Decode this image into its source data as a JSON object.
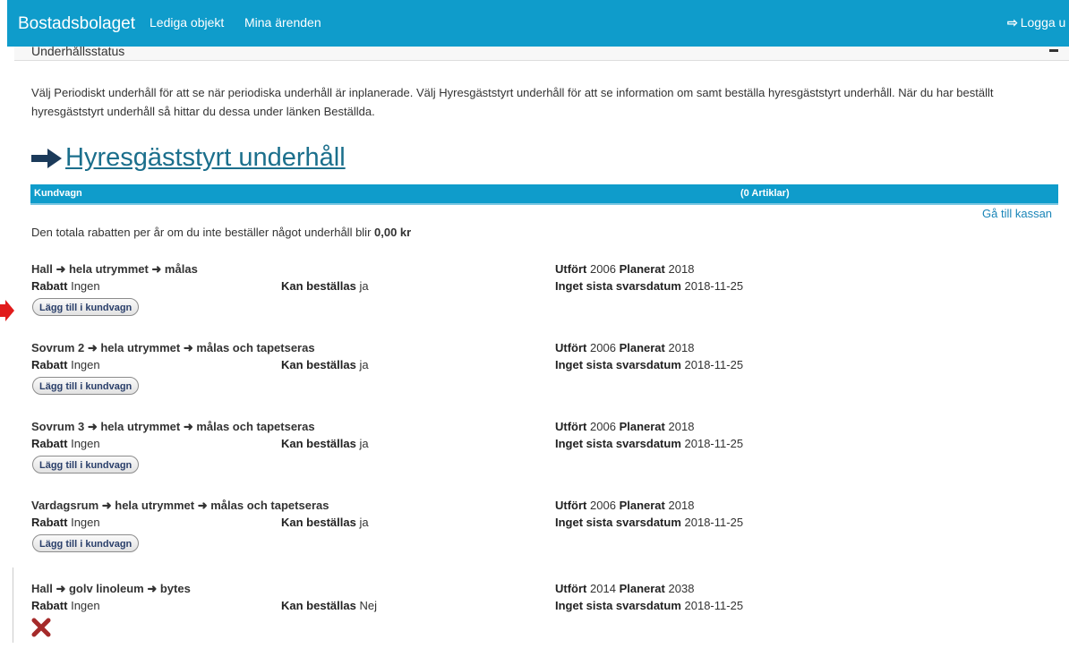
{
  "nav": {
    "brand": "Bostadsbolaget",
    "links": [
      "Lediga objekt",
      "Mina ärenden"
    ],
    "logout": "Logga u"
  },
  "panel": {
    "title": "Underhållsstatus"
  },
  "intro": "Välj Periodiskt underhåll för att se när periodiska underhåll är inplanerade. Välj Hyresgäststyrt underhåll för att se information om samt beställa hyresgäststyrt underhåll. När du har beställt hyresgäststyrt underhåll så hittar du dessa under länken Beställda.",
  "section_title": "Hyresgäststyrt underhåll",
  "cart": {
    "label": "Kundvagn",
    "count": "(0 Artiklar)"
  },
  "checkout": "Gå till kassan",
  "discount": {
    "text": "Den totala rabatten per år om du inte beställer något underhåll blir ",
    "amount": "0,00 kr"
  },
  "labels": {
    "done": "Utfört",
    "planned": "Planerat",
    "discount": "Rabatt",
    "orderable": "Kan beställas",
    "no_deadline": "Inget sista svarsdatum",
    "add_button": "Lägg till i kundvagn"
  },
  "arrow_glyph": "➜",
  "items": [
    {
      "title": "Hall ➜ hela utrymmet ➜ målas",
      "done": "2006",
      "planned": "2018",
      "discount": "Ingen",
      "orderable": "ja",
      "date": "2018-11-25"
    },
    {
      "title": "Sovrum 2 ➜ hela utrymmet ➜ målas och tapetseras",
      "done": "2006",
      "planned": "2018",
      "discount": "Ingen",
      "orderable": "ja",
      "date": "2018-11-25"
    },
    {
      "title": "Sovrum 3 ➜ hela utrymmet ➜ målas och tapetseras",
      "done": "2006",
      "planned": "2018",
      "discount": "Ingen",
      "orderable": "ja",
      "date": "2018-11-25"
    },
    {
      "title": "Vardagsrum ➜ hela utrymmet ➜ målas och tapetseras",
      "done": "2006",
      "planned": "2018",
      "discount": "Ingen",
      "orderable": "ja",
      "date": "2018-11-25"
    },
    {
      "title": "Hall ➜ golv linoleum ➜ bytes",
      "done": "2014",
      "planned": "2038",
      "discount": "Ingen",
      "orderable": "Nej",
      "date": "2018-11-25"
    }
  ],
  "colors": {
    "nav": "#0f9ccb",
    "title": "#1b6f8c",
    "link": "#1a85b8",
    "annotation_arrow": "#e11b1b",
    "x_mark": "#a52a2a"
  },
  "icons": [
    "logout-icon",
    "arrow-right-icon",
    "red-arrow-icon",
    "x-icon",
    "minus-icon"
  ]
}
